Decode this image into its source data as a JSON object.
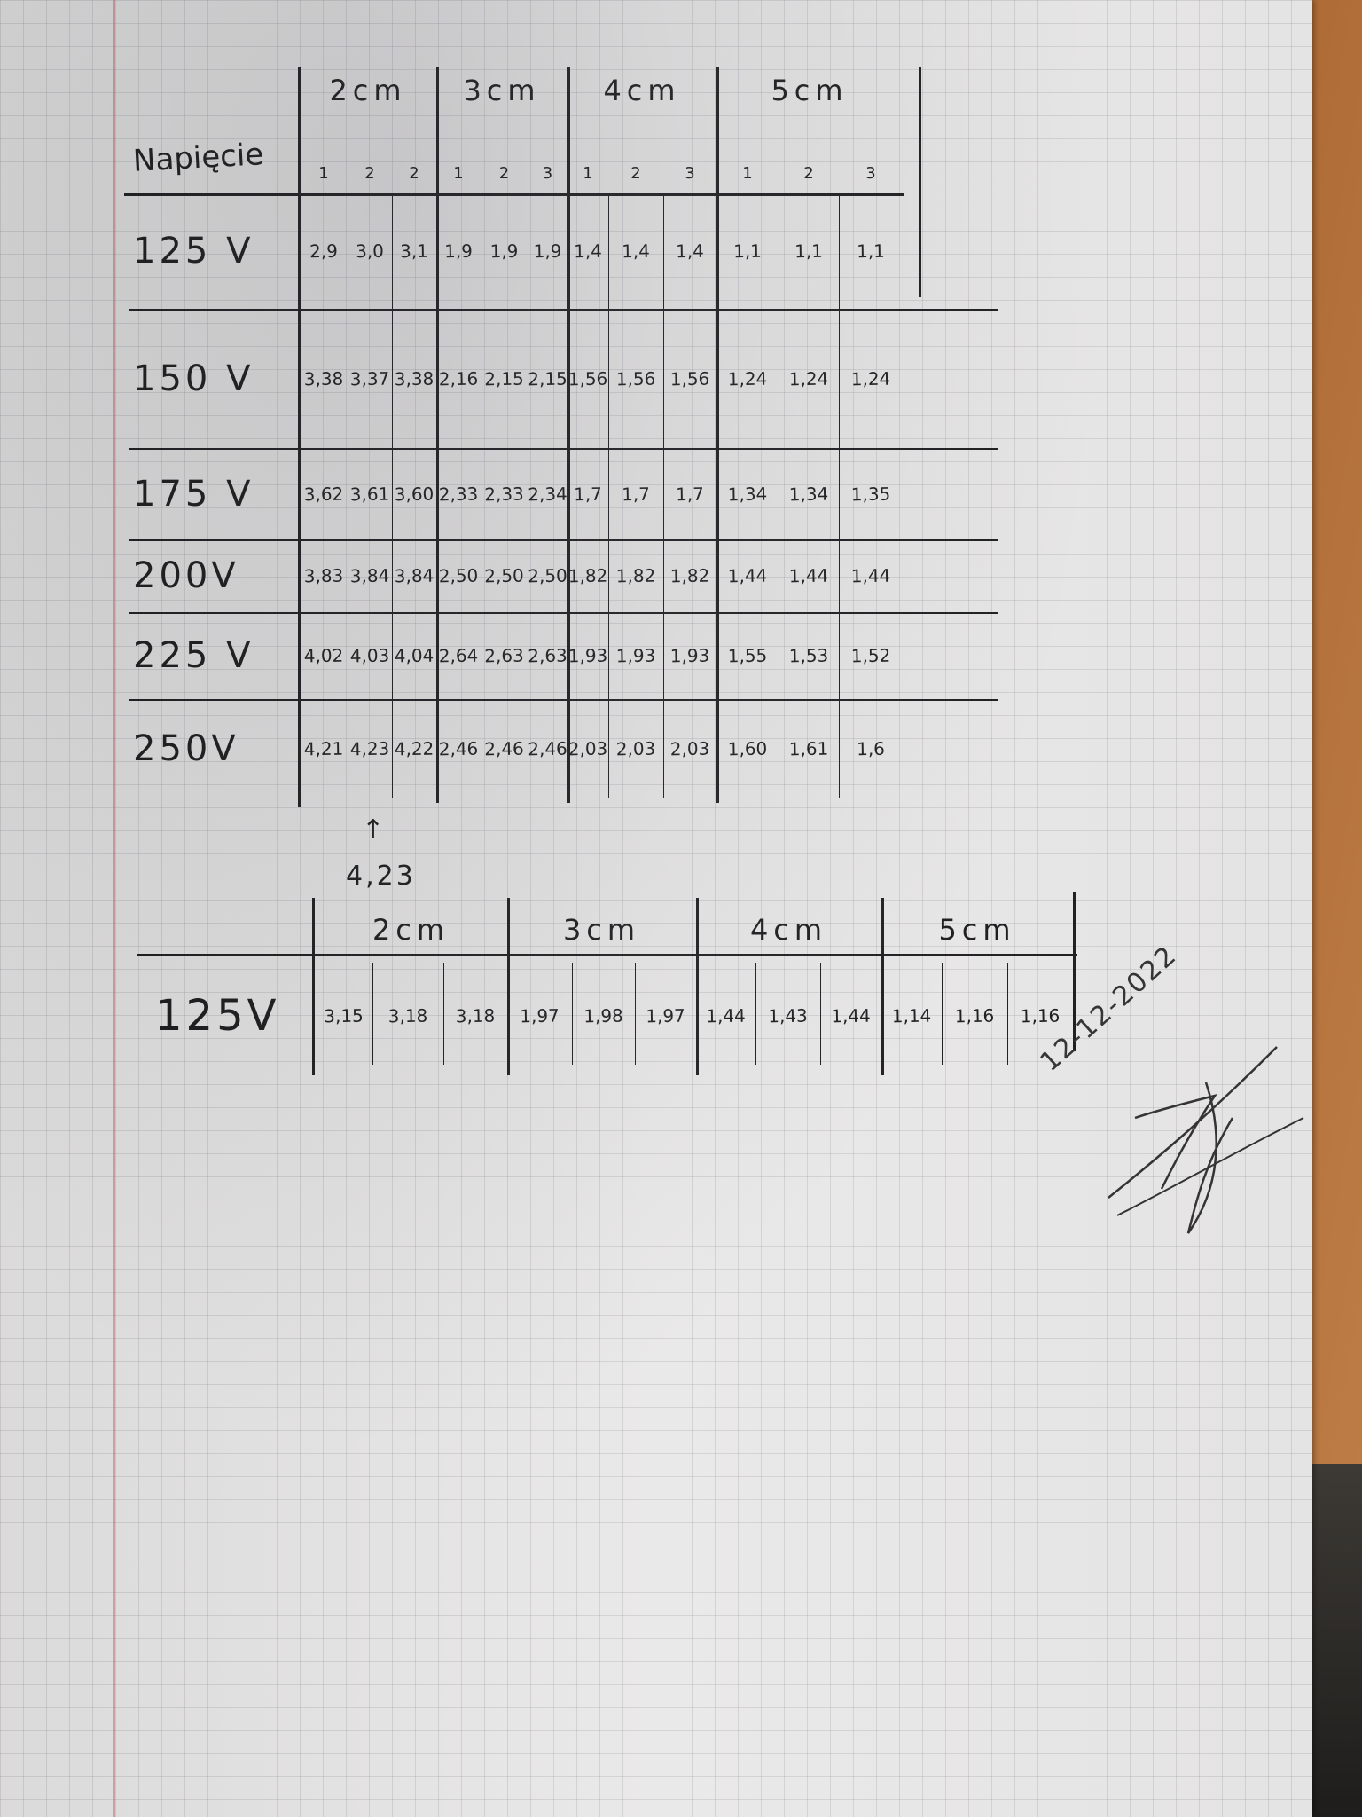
{
  "table1": {
    "row_header_label": "Napięcie",
    "groups": [
      "2cm",
      "3cm",
      "4cm",
      "5cm"
    ],
    "trials": [
      "1",
      "2",
      "2",
      "1",
      "2",
      "3",
      "1",
      "2",
      "3",
      "1",
      "2",
      "3"
    ],
    "rows": [
      {
        "voltage": "125 V",
        "values": [
          "2,9",
          "3,0",
          "3,1",
          "1,9",
          "1,9",
          "1,9",
          "1,4",
          "1,4",
          "1,4",
          "1,1",
          "1,1",
          "1,1"
        ]
      },
      {
        "voltage": "150 V",
        "values": [
          "3,38",
          "3,37",
          "3,38",
          "2,16",
          "2,15",
          "2,15",
          "1,56",
          "1,56",
          "1,56",
          "1,24",
          "1,24",
          "1,24"
        ]
      },
      {
        "voltage": "175 V",
        "values": [
          "3,62",
          "3,61",
          "3,60",
          "2,33",
          "2,33",
          "2,34",
          "1,7",
          "1,7",
          "1,7",
          "1,34",
          "1,34",
          "1,35"
        ]
      },
      {
        "voltage": "200V",
        "values": [
          "3,83",
          "3,84",
          "3,84",
          "2,50",
          "2,50",
          "2,50",
          "1,82",
          "1,82",
          "1,82",
          "1,44",
          "1,44",
          "1,44"
        ]
      },
      {
        "voltage": "225 V",
        "values": [
          "4,02",
          "4,03",
          "4,04",
          "2,64",
          "2,63",
          "2,63",
          "1,93",
          "1,93",
          "1,93",
          "1,55",
          "1,53",
          "1,52"
        ]
      },
      {
        "voltage": "250V",
        "values": [
          "4,21",
          "4,23",
          "4,22",
          "2,46",
          "2,46",
          "2,46",
          "2,03",
          "2,03",
          "2,03",
          "1,60",
          "1,61",
          "1,6"
        ]
      }
    ],
    "annotation": "4,23"
  },
  "table2": {
    "groups": [
      "2cm",
      "3cm",
      "4cm",
      "5cm"
    ],
    "rows": [
      {
        "voltage": "125V",
        "values": [
          "3,15",
          "3,18",
          "3,18",
          "1,97",
          "1,98",
          "1,97",
          "1,44",
          "1,43",
          "1,44",
          "1,14",
          "1,16",
          "1,16"
        ]
      }
    ]
  },
  "signature": {
    "date": "12-12-2022"
  },
  "colors": {
    "ink": "#1b1b1d",
    "paper": "#e9e8e8",
    "grid": "#9696a0",
    "desk": "#b97a45"
  }
}
